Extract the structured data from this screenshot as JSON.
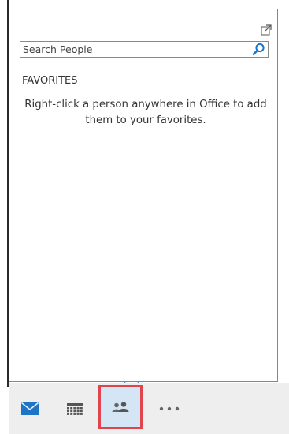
{
  "people_pane": {
    "search": {
      "placeholder": "Search People",
      "value": ""
    },
    "favorites_heading": "FAVORITES",
    "favorites_hint": "Right-click a person anywhere in Office to add them to your favorites."
  },
  "navigation": {
    "items": [
      {
        "name": "Mail",
        "icon": "envelope-icon"
      },
      {
        "name": "Calendar",
        "icon": "calendar-icon"
      },
      {
        "name": "People",
        "icon": "people-icon",
        "selected": true
      },
      {
        "name": "More",
        "icon": "ellipsis-icon"
      }
    ]
  },
  "colors": {
    "accent": "#1e75c8",
    "panel_border": "#5b8fc7",
    "selected_background": "#d4e6f6",
    "highlight_box": "#e0444d",
    "nav_background": "#eeeeee"
  }
}
